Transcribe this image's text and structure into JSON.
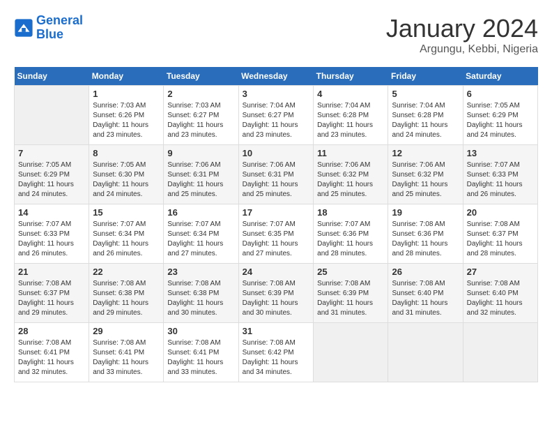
{
  "header": {
    "logo_line1": "General",
    "logo_line2": "Blue",
    "month": "January 2024",
    "location": "Argungu, Kebbi, Nigeria"
  },
  "weekdays": [
    "Sunday",
    "Monday",
    "Tuesday",
    "Wednesday",
    "Thursday",
    "Friday",
    "Saturday"
  ],
  "weeks": [
    [
      {
        "day": "",
        "sunrise": "",
        "sunset": "",
        "daylight": ""
      },
      {
        "day": "1",
        "sunrise": "7:03 AM",
        "sunset": "6:26 PM",
        "daylight": "11 hours and 23 minutes."
      },
      {
        "day": "2",
        "sunrise": "7:03 AM",
        "sunset": "6:27 PM",
        "daylight": "11 hours and 23 minutes."
      },
      {
        "day": "3",
        "sunrise": "7:04 AM",
        "sunset": "6:27 PM",
        "daylight": "11 hours and 23 minutes."
      },
      {
        "day": "4",
        "sunrise": "7:04 AM",
        "sunset": "6:28 PM",
        "daylight": "11 hours and 23 minutes."
      },
      {
        "day": "5",
        "sunrise": "7:04 AM",
        "sunset": "6:28 PM",
        "daylight": "11 hours and 24 minutes."
      },
      {
        "day": "6",
        "sunrise": "7:05 AM",
        "sunset": "6:29 PM",
        "daylight": "11 hours and 24 minutes."
      }
    ],
    [
      {
        "day": "7",
        "sunrise": "7:05 AM",
        "sunset": "6:29 PM",
        "daylight": "11 hours and 24 minutes."
      },
      {
        "day": "8",
        "sunrise": "7:05 AM",
        "sunset": "6:30 PM",
        "daylight": "11 hours and 24 minutes."
      },
      {
        "day": "9",
        "sunrise": "7:06 AM",
        "sunset": "6:31 PM",
        "daylight": "11 hours and 25 minutes."
      },
      {
        "day": "10",
        "sunrise": "7:06 AM",
        "sunset": "6:31 PM",
        "daylight": "11 hours and 25 minutes."
      },
      {
        "day": "11",
        "sunrise": "7:06 AM",
        "sunset": "6:32 PM",
        "daylight": "11 hours and 25 minutes."
      },
      {
        "day": "12",
        "sunrise": "7:06 AM",
        "sunset": "6:32 PM",
        "daylight": "11 hours and 25 minutes."
      },
      {
        "day": "13",
        "sunrise": "7:07 AM",
        "sunset": "6:33 PM",
        "daylight": "11 hours and 26 minutes."
      }
    ],
    [
      {
        "day": "14",
        "sunrise": "7:07 AM",
        "sunset": "6:33 PM",
        "daylight": "11 hours and 26 minutes."
      },
      {
        "day": "15",
        "sunrise": "7:07 AM",
        "sunset": "6:34 PM",
        "daylight": "11 hours and 26 minutes."
      },
      {
        "day": "16",
        "sunrise": "7:07 AM",
        "sunset": "6:34 PM",
        "daylight": "11 hours and 27 minutes."
      },
      {
        "day": "17",
        "sunrise": "7:07 AM",
        "sunset": "6:35 PM",
        "daylight": "11 hours and 27 minutes."
      },
      {
        "day": "18",
        "sunrise": "7:07 AM",
        "sunset": "6:36 PM",
        "daylight": "11 hours and 28 minutes."
      },
      {
        "day": "19",
        "sunrise": "7:08 AM",
        "sunset": "6:36 PM",
        "daylight": "11 hours and 28 minutes."
      },
      {
        "day": "20",
        "sunrise": "7:08 AM",
        "sunset": "6:37 PM",
        "daylight": "11 hours and 28 minutes."
      }
    ],
    [
      {
        "day": "21",
        "sunrise": "7:08 AM",
        "sunset": "6:37 PM",
        "daylight": "11 hours and 29 minutes."
      },
      {
        "day": "22",
        "sunrise": "7:08 AM",
        "sunset": "6:38 PM",
        "daylight": "11 hours and 29 minutes."
      },
      {
        "day": "23",
        "sunrise": "7:08 AM",
        "sunset": "6:38 PM",
        "daylight": "11 hours and 30 minutes."
      },
      {
        "day": "24",
        "sunrise": "7:08 AM",
        "sunset": "6:39 PM",
        "daylight": "11 hours and 30 minutes."
      },
      {
        "day": "25",
        "sunrise": "7:08 AM",
        "sunset": "6:39 PM",
        "daylight": "11 hours and 31 minutes."
      },
      {
        "day": "26",
        "sunrise": "7:08 AM",
        "sunset": "6:40 PM",
        "daylight": "11 hours and 31 minutes."
      },
      {
        "day": "27",
        "sunrise": "7:08 AM",
        "sunset": "6:40 PM",
        "daylight": "11 hours and 32 minutes."
      }
    ],
    [
      {
        "day": "28",
        "sunrise": "7:08 AM",
        "sunset": "6:41 PM",
        "daylight": "11 hours and 32 minutes."
      },
      {
        "day": "29",
        "sunrise": "7:08 AM",
        "sunset": "6:41 PM",
        "daylight": "11 hours and 33 minutes."
      },
      {
        "day": "30",
        "sunrise": "7:08 AM",
        "sunset": "6:41 PM",
        "daylight": "11 hours and 33 minutes."
      },
      {
        "day": "31",
        "sunrise": "7:08 AM",
        "sunset": "6:42 PM",
        "daylight": "11 hours and 34 minutes."
      },
      {
        "day": "",
        "sunrise": "",
        "sunset": "",
        "daylight": ""
      },
      {
        "day": "",
        "sunrise": "",
        "sunset": "",
        "daylight": ""
      },
      {
        "day": "",
        "sunrise": "",
        "sunset": "",
        "daylight": ""
      }
    ]
  ]
}
